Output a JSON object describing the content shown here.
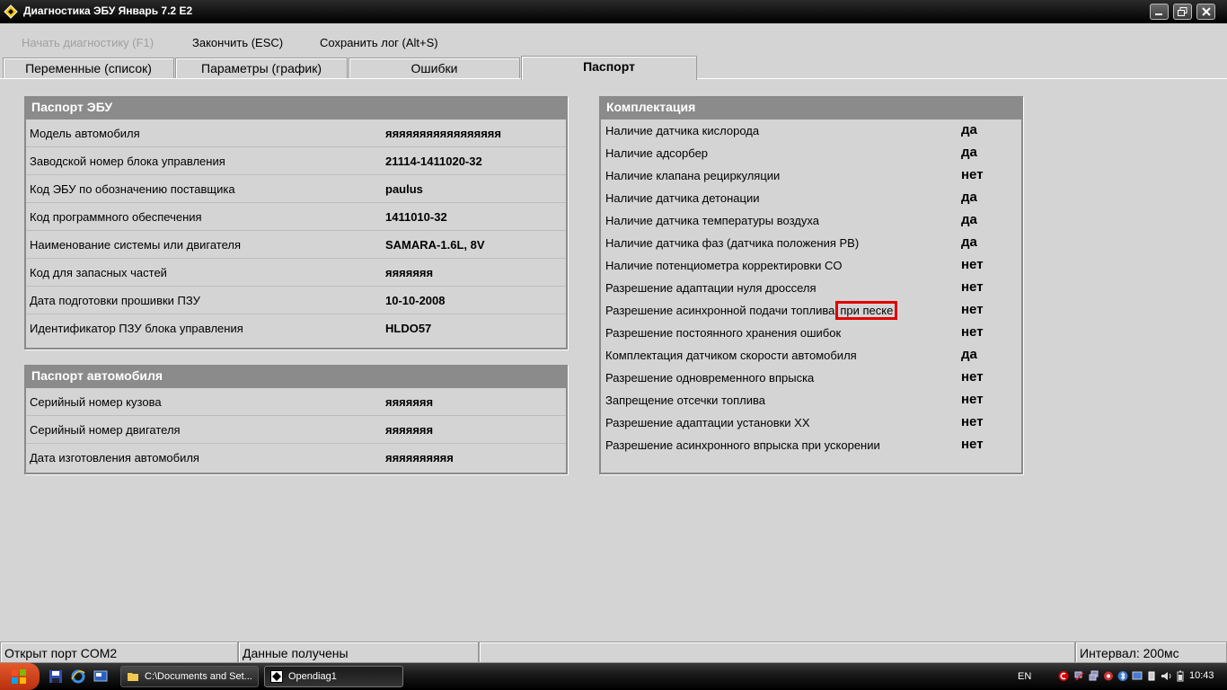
{
  "window": {
    "title": "Диагностика ЭБУ Январь 7.2 E2"
  },
  "menu": {
    "start_diag": "Начать диагностику (F1)",
    "finish": "Закончить (ESC)",
    "save_log": "Сохранить лог (Alt+S)"
  },
  "tabs": [
    {
      "label": "Переменные (список)",
      "active": false
    },
    {
      "label": "Параметры (график)",
      "active": false
    },
    {
      "label": "Ошибки",
      "active": false
    },
    {
      "label": "Паспорт",
      "active": true
    }
  ],
  "ecu_passport": {
    "title": "Паспорт ЭБУ",
    "rows": [
      {
        "label": "Модель автомобиля",
        "value": "яяяяяяяяяяяяяяяяя"
      },
      {
        "label": "Заводской номер блока управления",
        "value": "21114-1411020-32"
      },
      {
        "label": "Код ЭБУ по обозначению поставщика",
        "value": "paulus"
      },
      {
        "label": "Код программного обеспечения",
        "value": "1411010-32"
      },
      {
        "label": "Наименование системы или двигателя",
        "value": "SAMARA-1.6L, 8V"
      },
      {
        "label": "Код для запасных частей",
        "value": "яяяяяяя"
      },
      {
        "label": "Дата подготовки прошивки ПЗУ",
        "value": "10-10-2008"
      },
      {
        "label": "Идентификатор ПЗУ блока управления",
        "value": "HLDO57"
      }
    ]
  },
  "car_passport": {
    "title": "Паспорт автомобиля",
    "rows": [
      {
        "label": "Серийный номер кузова",
        "value": "яяяяяяя"
      },
      {
        "label": "Серийный номер двигателя",
        "value": "яяяяяяя"
      },
      {
        "label": "Дата изготовления автомобиля",
        "value": "яяяяяяяяяя"
      }
    ]
  },
  "equipment": {
    "title": "Комплектация",
    "rows": [
      {
        "label": "Наличие датчика кислорода",
        "value": "да"
      },
      {
        "label": "Наличие адсорбер",
        "value": "да"
      },
      {
        "label": "Наличие клапана рециркуляции",
        "value": "нет"
      },
      {
        "label": "Наличие датчика детонации",
        "value": "да"
      },
      {
        "label": "Наличие датчика температуры воздуха",
        "value": "да"
      },
      {
        "label": "Наличие датчика фаз (датчика положения РВ)",
        "value": "да"
      },
      {
        "label": "Наличие потенциометра корректировки CO",
        "value": "нет"
      },
      {
        "label": "Разрешение адаптации нуля дросселя",
        "value": "нет"
      },
      {
        "label": "Разрешение асинхронной подачи топлива",
        "highlight": "при песке",
        "value": "нет"
      },
      {
        "label": "Разрешение постоянного хранения ошибок",
        "value": "нет"
      },
      {
        "label": "Комплектация датчиком скорости автомобиля",
        "value": "да"
      },
      {
        "label": "Разрешение одновременного впрыска",
        "value": "нет"
      },
      {
        "label": "Запрещение отсечки топлива",
        "value": "нет"
      },
      {
        "label": "Разрешение адаптации установки XX",
        "value": "нет"
      },
      {
        "label": "Разрешение асинхронного впрыска при ускорении",
        "value": "нет"
      }
    ]
  },
  "status": {
    "port": "Открыт порт COM2",
    "data": "Данные получены",
    "empty": "",
    "interval": "Интервал: 200мс"
  },
  "taskbar": {
    "tasks": [
      {
        "label": "C:\\Documents and Set...",
        "icon": "folder-icon"
      },
      {
        "label": "Opendiag1",
        "icon": "app-icon"
      }
    ],
    "lang": "EN",
    "clock": "10:43"
  },
  "colors": {
    "highlight_border": "#e00000",
    "panel_header": "#8b8b8b",
    "background": "#d4d4d4"
  }
}
